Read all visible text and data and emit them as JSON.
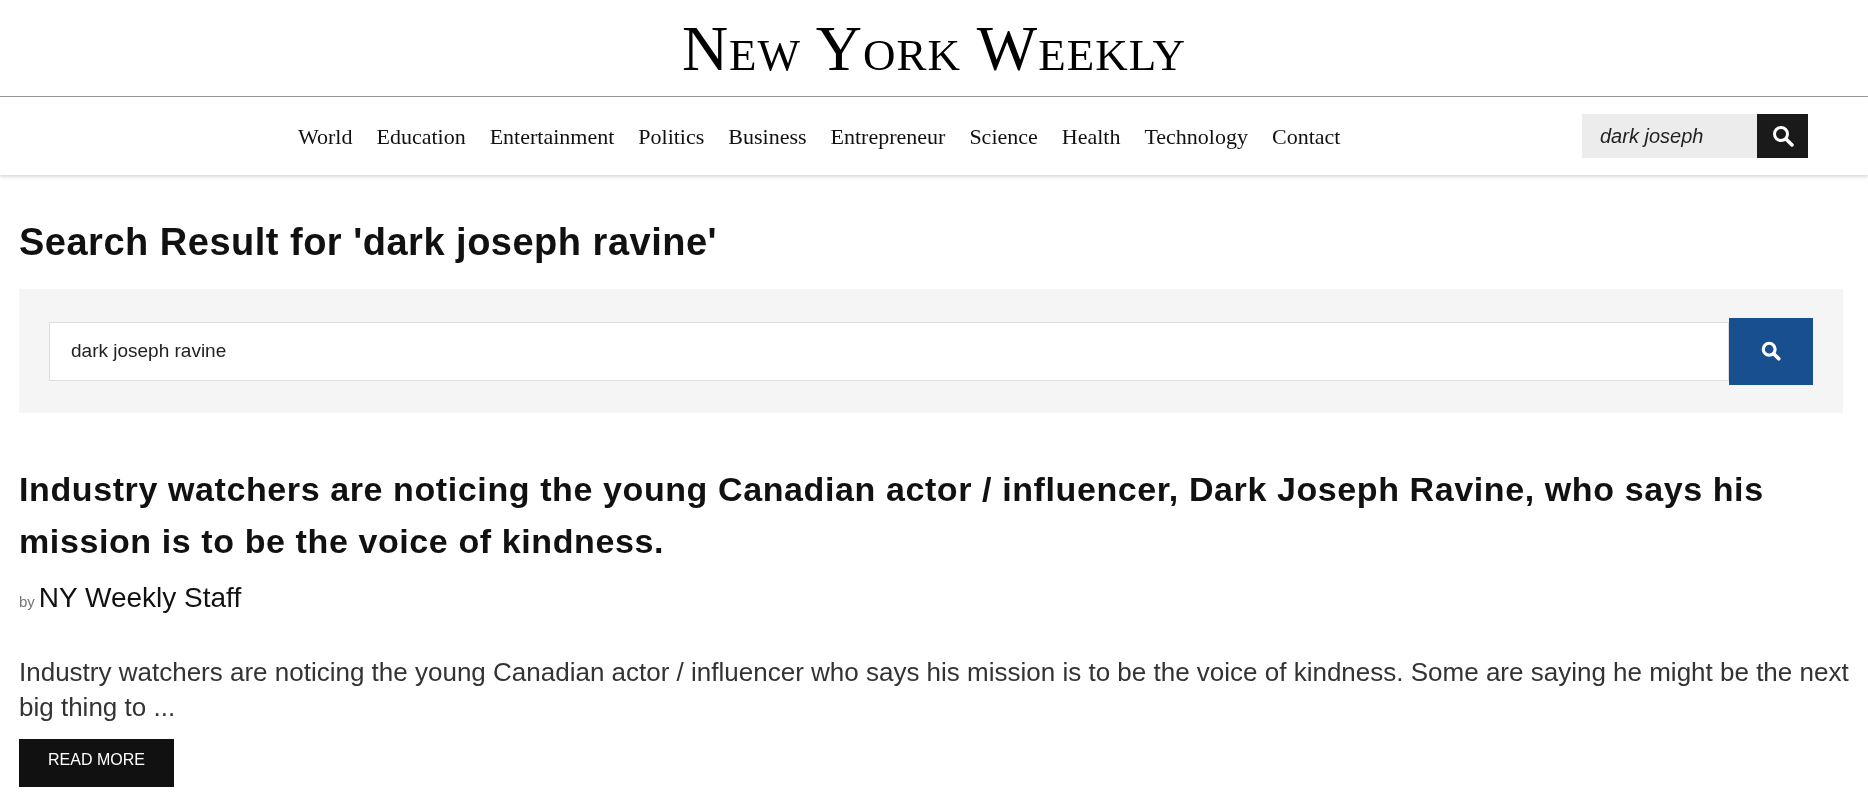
{
  "logo": "New York Weekly",
  "nav": {
    "items": [
      {
        "label": "World"
      },
      {
        "label": "Education"
      },
      {
        "label": "Entertainment"
      },
      {
        "label": "Politics"
      },
      {
        "label": "Business"
      },
      {
        "label": "Entrepreneur"
      },
      {
        "label": "Science"
      },
      {
        "label": "Health"
      },
      {
        "label": "Technology"
      },
      {
        "label": "Contact"
      }
    ],
    "search": {
      "value": "dark joseph"
    }
  },
  "heading": "Search Result for 'dark joseph ravine'",
  "search_panel": {
    "value": "dark joseph ravine"
  },
  "results": [
    {
      "title": "Industry watchers are noticing the young Canadian actor / influencer, Dark Joseph Ravine, who says his mission is to be the voice of kindness.",
      "by": "by",
      "author": "NY Weekly Staff",
      "excerpt": "Industry watchers are noticing the young Canadian actor / influencer who says his mission is to be the voice of kindness. Some are saying he might be the next big thing to ...",
      "button": "READ MORE"
    }
  ]
}
